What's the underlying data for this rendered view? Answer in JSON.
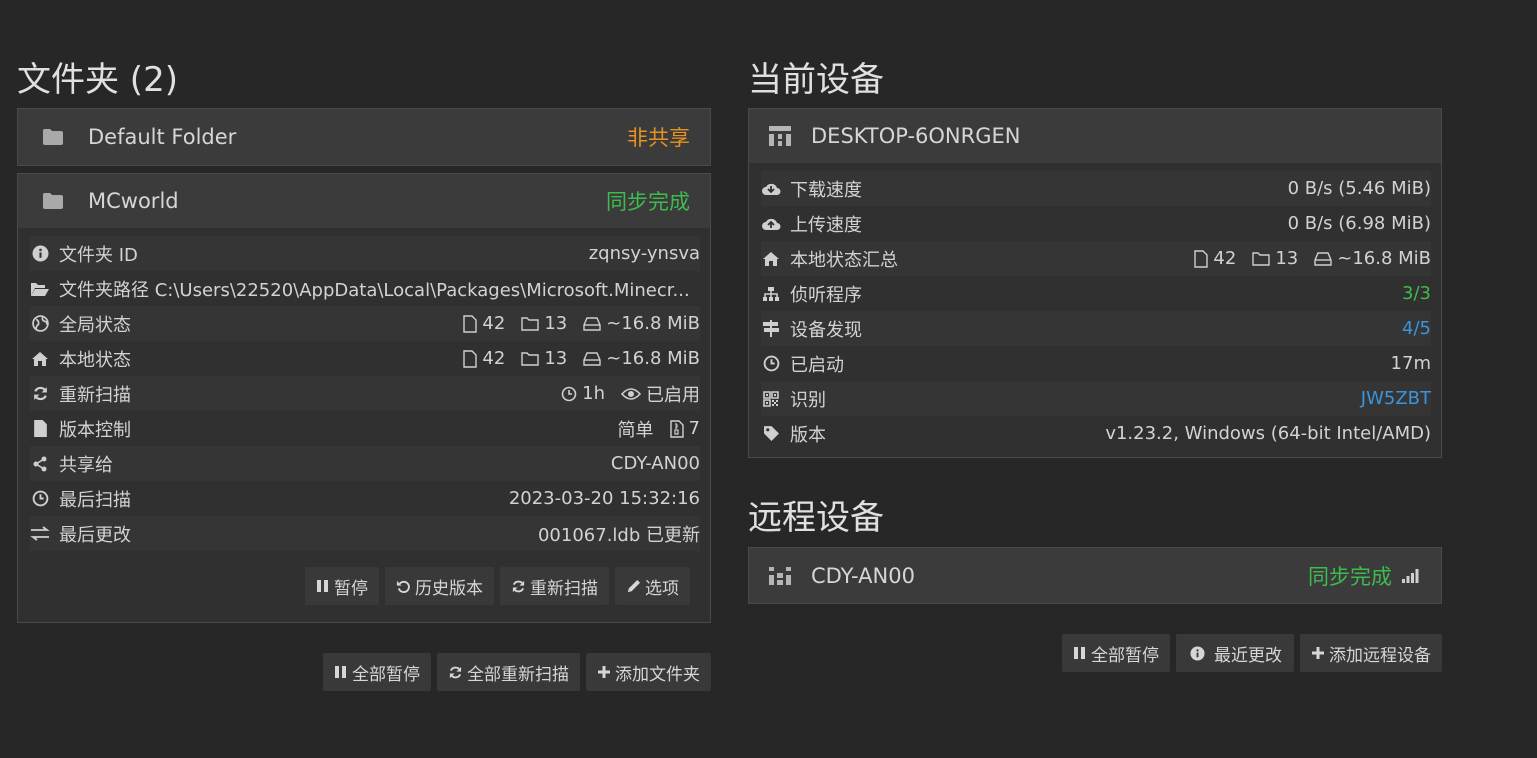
{
  "folders_section": {
    "title": "文件夹 (2)",
    "folders": [
      {
        "name": "Default Folder",
        "status": "非共享",
        "status_color": "#e69220"
      },
      {
        "name": "MCworld",
        "status": "同步完成",
        "status_color": "#3dbb4e"
      }
    ],
    "details": {
      "folder_id": {
        "label": "文件夹 ID",
        "value": "zqnsy-ynsva"
      },
      "folder_path": {
        "label": "文件夹路径",
        "value": "C:\\Users\\22520\\AppData\\Local\\Packages\\Microsoft.Minecr..."
      },
      "global_state": {
        "label": "全局状态",
        "files": "42",
        "dirs": "13",
        "size": "~16.8 MiB"
      },
      "local_state": {
        "label": "本地状态",
        "files": "42",
        "dirs": "13",
        "size": "~16.8 MiB"
      },
      "rescan": {
        "label": "重新扫描",
        "interval": "1h",
        "watch": "已启用"
      },
      "versioning": {
        "label": "版本控制",
        "type": "简单",
        "keep": "7"
      },
      "shared_with": {
        "label": "共享给",
        "value": "CDY-AN00"
      },
      "last_scan": {
        "label": "最后扫描",
        "value": "2023-03-20 15:32:16"
      },
      "last_change": {
        "label": "最后更改",
        "value": "001067.ldb 已更新"
      }
    },
    "folder_buttons": {
      "pause": "暂停",
      "history": "历史版本",
      "rescan": "重新扫描",
      "options": "选项"
    },
    "footer_buttons": {
      "pause_all": "全部暂停",
      "rescan_all": "全部重新扫描",
      "add_folder": "添加文件夹"
    }
  },
  "this_device": {
    "title": "当前设备",
    "name": "DESKTOP-6ONRGEN",
    "rows": {
      "download": {
        "label": "下载速度",
        "value": "0 B/s (5.46 MiB)"
      },
      "upload": {
        "label": "上传速度",
        "value": "0 B/s (6.98 MiB)"
      },
      "local_summary": {
        "label": "本地状态汇总",
        "files": "42",
        "dirs": "13",
        "size": "~16.8 MiB"
      },
      "listeners": {
        "label": "侦听程序",
        "value": "3/3",
        "color": "#3dbb4e"
      },
      "discovery": {
        "label": "设备发现",
        "value": "4/5",
        "color": "#3a95dc"
      },
      "uptime": {
        "label": "已启动",
        "value": "17m"
      },
      "identity": {
        "label": "识别",
        "value": "JW5ZBT",
        "color": "#3a95dc"
      },
      "version": {
        "label": "版本",
        "value": "v1.23.2, Windows (64-bit Intel/AMD)"
      }
    }
  },
  "remote_devices": {
    "title": "远程设备",
    "devices": [
      {
        "name": "CDY-AN00",
        "status": "同步完成",
        "status_color": "#3dbb4e"
      }
    ],
    "footer_buttons": {
      "pause_all": "全部暂停",
      "recent_changes": "最近更改",
      "add_remote": "添加远程设备"
    }
  },
  "icons": [
    "folder-icon",
    "info-icon",
    "folder-open-icon",
    "globe-icon",
    "home-icon",
    "refresh-icon",
    "file-icon",
    "share-icon",
    "clock-icon",
    "exchange-icon",
    "pause-icon",
    "undo-icon",
    "pencil-icon",
    "plus-icon",
    "sitemap-icon",
    "cloud-download-icon",
    "cloud-upload-icon",
    "signpost-icon",
    "qrcode-icon",
    "tag-icon",
    "desktop-icon",
    "signal-icon",
    "eye-icon",
    "hdd-icon",
    "file-zip-icon"
  ]
}
